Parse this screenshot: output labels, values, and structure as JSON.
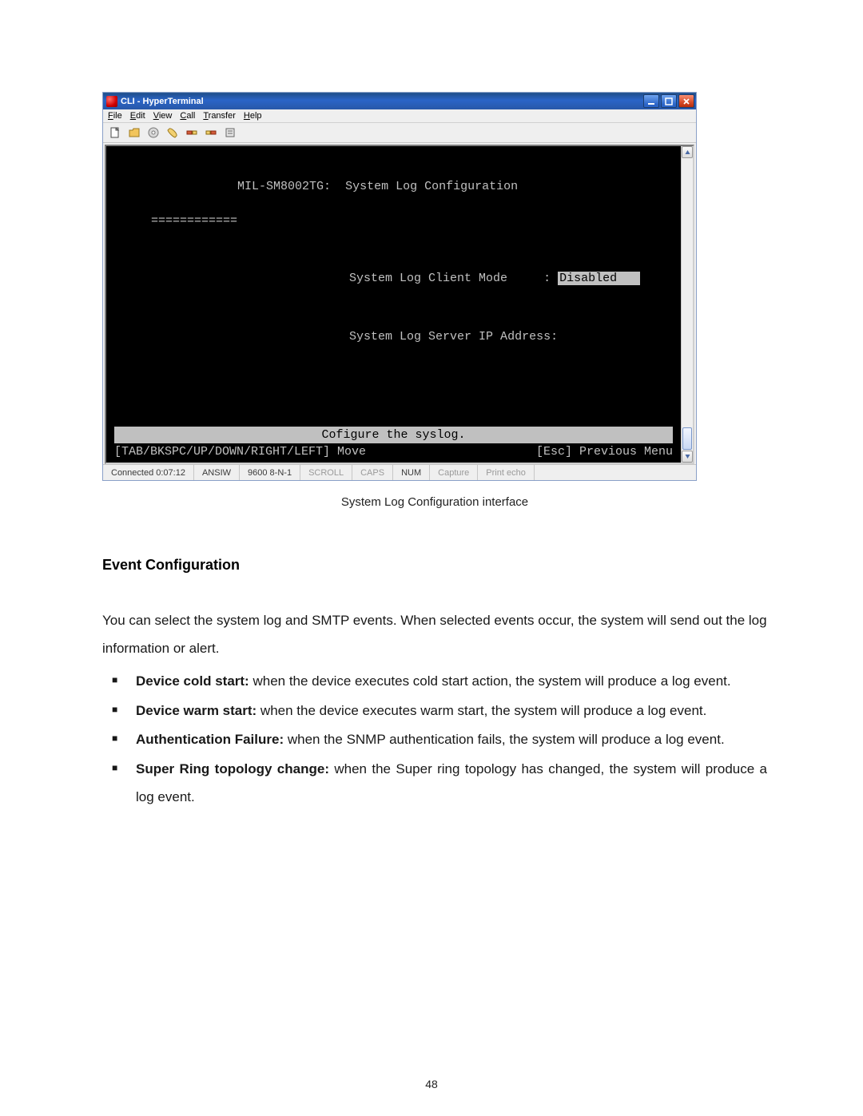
{
  "window": {
    "title": "CLI - HyperTerminal",
    "menus": [
      "File",
      "Edit",
      "View",
      "Call",
      "Transfer",
      "Help"
    ],
    "toolbar_icons": [
      "new-file-icon",
      "open-folder-icon",
      "disk-icon",
      "phone-icon",
      "hangup-left-icon",
      "hangup-right-icon",
      "properties-icon"
    ]
  },
  "terminal": {
    "device": "MIL-SM8002TG:",
    "screen_title": "System Log Configuration",
    "underline": "============",
    "field1_label": "System Log Client Mode",
    "field1_sep": ":",
    "field1_value": "Disabled   ",
    "field2_label": "System Log Server IP Address:",
    "hint": "Cofigure the syslog.",
    "nav_left": "[TAB/BKSPC/UP/DOWN/RIGHT/LEFT] Move",
    "nav_right": "[Esc] Previous Menu"
  },
  "statusbar": {
    "connected": "Connected 0:07:12",
    "emulation": "ANSIW",
    "serial": "9600 8-N-1",
    "cells": [
      "SCROLL",
      "CAPS",
      "NUM",
      "Capture",
      "Print echo"
    ]
  },
  "caption": "System Log Configuration interface",
  "section_heading": "Event Configuration",
  "paragraph": "You can select the system log and SMTP events. When selected events occur, the system will send out the log information or alert.",
  "bullets": [
    {
      "bold": "Device cold start:",
      "rest": " when the device executes cold start action, the system will produce a log event."
    },
    {
      "bold": "Device warm start:",
      "rest": " when the device executes warm start, the system will produce a log event."
    },
    {
      "bold": "Authentication Failure:",
      "rest": " when the SNMP authentication fails, the system will produce a log event."
    },
    {
      "bold": "Super Ring topology change:",
      "rest": " when the Super ring topology has changed, the system will produce a log event."
    }
  ],
  "page_number": "48"
}
